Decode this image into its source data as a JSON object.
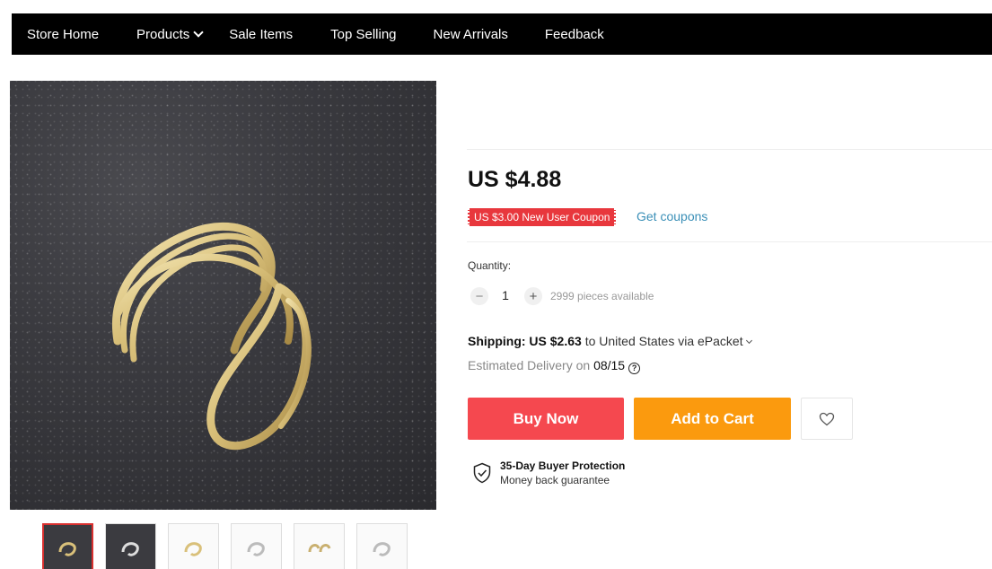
{
  "nav": {
    "items": [
      "Store Home",
      "Products",
      "Sale Items",
      "Top Selling",
      "New Arrivals",
      "Feedback"
    ]
  },
  "product": {
    "price": "US $4.88",
    "coupon_label": "US $3.00 New User Coupon",
    "get_coupons": "Get coupons",
    "quantity_label": "Quantity:",
    "quantity_value": "1",
    "minus_symbol": "−",
    "plus_symbol": "+",
    "available": "2999 pieces available",
    "shipping_prefix": "Shipping: US $2.63",
    "shipping_suffix": " to United States via ePacket",
    "delivery_prefix": "Estimated Delivery on ",
    "delivery_date": "08/15",
    "buy_now": "Buy Now",
    "add_to_cart": "Add to Cart",
    "protection_title": "35-Day Buyer Protection",
    "protection_sub": "Money back guarantee"
  },
  "icons": {
    "products_chevron": "chevron-down-icon",
    "shipping_chevron": "chevron-down-icon",
    "help": "question-icon",
    "wishlist": "heart-icon",
    "protection": "shield-check-icon"
  },
  "colors": {
    "nav_bg": "#000000",
    "buy_now": "#f5484f",
    "add_to_cart": "#fb9a0e",
    "coupon": "#e8373d",
    "link": "#3a8fb7",
    "active_thumb_border": "#d9302f"
  },
  "gallery": {
    "thumbnail_count": 6,
    "active_index": 0
  }
}
